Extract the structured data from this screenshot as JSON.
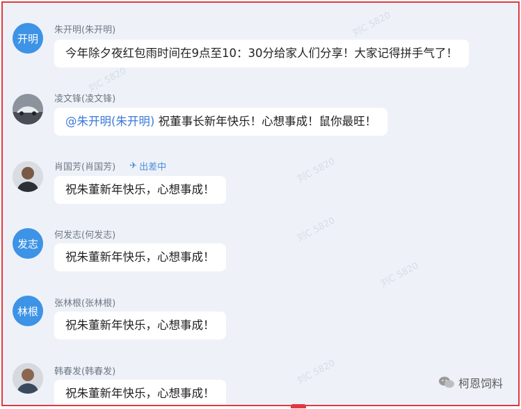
{
  "messages": [
    {
      "avatar_text": "开明",
      "avatar_badge": "",
      "sender": "朱开明(朱开明)",
      "status": "",
      "mention": "",
      "text": "今年除夕夜红包雨时间在9点至10：30分给家人们分享！大家记得拼手气了！"
    },
    {
      "avatar_text": "",
      "avatar_badge": "",
      "sender": "凌文锋(凌文锋)",
      "status": "",
      "mention": "@朱开明(朱开明)",
      "text": " 祝董事长新年快乐！心想事成！鼠你最旺！"
    },
    {
      "avatar_text": "",
      "avatar_badge": "",
      "sender": "肖国芳(肖国芳)",
      "status": "出差中",
      "mention": "",
      "text": "祝朱董新年快乐，心想事成！"
    },
    {
      "avatar_text": "发志",
      "avatar_badge": "",
      "sender": "何发志(何发志)",
      "status": "",
      "mention": "",
      "text": "祝朱董新年快乐，心想事成！"
    },
    {
      "avatar_text": "林根",
      "avatar_badge": "",
      "sender": "张林根(张林根)",
      "status": "",
      "mention": "",
      "text": "祝朱董新年快乐，心想事成！"
    },
    {
      "avatar_text": "",
      "avatar_badge": "",
      "sender": "韩春发(韩春发)",
      "status": "",
      "mention": "",
      "text": "祝朱董新年快乐，心想事成！"
    }
  ],
  "footer": {
    "brand": "柯恩饲料"
  },
  "colors": {
    "frame": "#e0393e",
    "background": "#eef2f8",
    "avatar_blue": "#3d93e6",
    "mention": "#3b7ad9"
  }
}
